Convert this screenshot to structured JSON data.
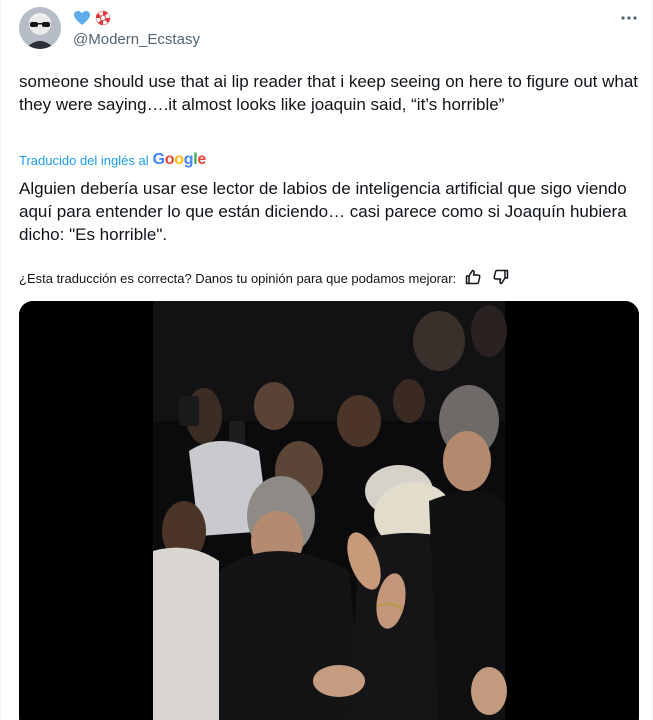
{
  "tweet": {
    "author_handle": "@Modern_Ecstasy",
    "name_icons": [
      "blue-heart-icon",
      "lifebuoy-icon"
    ],
    "text": "someone should use that ai lip reader that i keep seeing on here to figure out what they were saying….it almost looks like joaquin said, “it’s horrible”",
    "translation": {
      "label": "Traducido del inglés al",
      "provider": {
        "letters": [
          "G",
          "o",
          "o",
          "g",
          "l",
          "e"
        ],
        "colors": [
          "#4285f4",
          "#ea4335",
          "#fbbc05",
          "#4285f4",
          "#34a853",
          "#ea4335"
        ]
      },
      "text": "Alguien debería usar ese lector de labios de inteligencia artificial que sigo viendo aquí para entender lo que están diciendo… casi parece como si Joaquín hubiera dicho: \"Es horrible\"."
    },
    "feedback": {
      "question": "¿Esta traducción es correcta? Danos tu opinión para que podamos mejorar:"
    }
  },
  "colors": {
    "link_blue": "#1d9bf0",
    "secondary_text": "#536471",
    "heart_blue": "#5dadec",
    "lifebuoy_red": "#e0383e",
    "media_background": "#000000"
  }
}
